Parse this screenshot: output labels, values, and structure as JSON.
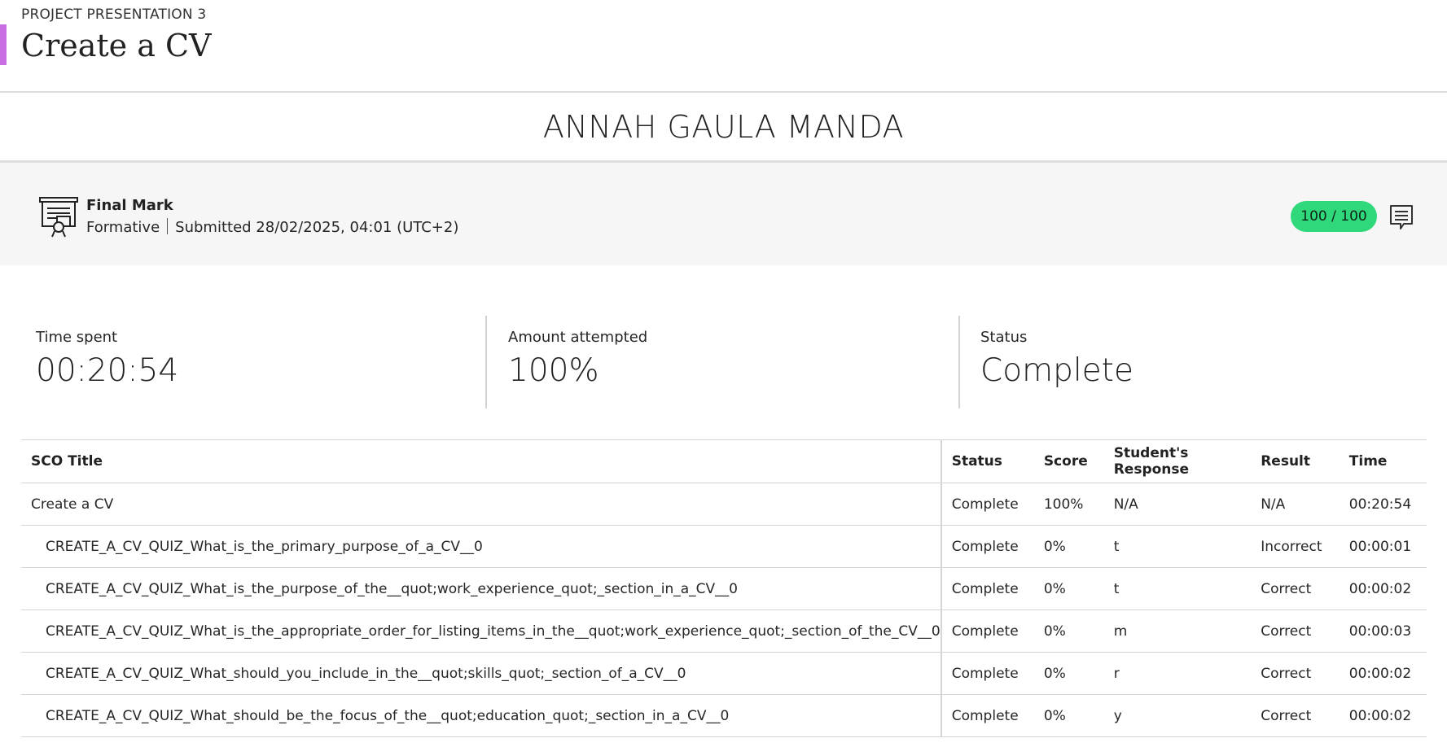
{
  "header": {
    "breadcrumb": "PROJECT PRESENTATION 3",
    "title": "Create a CV",
    "accent_color": "#c86ee0"
  },
  "student": {
    "name": "ANNAH GAULA MANDA"
  },
  "grade": {
    "icon": "certificate-icon",
    "label": "Final Mark",
    "type": "Formative",
    "submitted": "Submitted 28/02/2025, 04:01 (UTC+2)",
    "score": "100 / 100",
    "score_color": "#2fd87a",
    "comment_icon": "comment-icon"
  },
  "stats": {
    "time_spent": {
      "label": "Time spent",
      "value": "00:20:54"
    },
    "amount_attempted": {
      "label": "Amount attempted",
      "value": "100%"
    },
    "status": {
      "label": "Status",
      "value": "Complete"
    }
  },
  "table": {
    "headers": {
      "title": "SCO Title",
      "status": "Status",
      "score": "Score",
      "response": "Student's Response",
      "result": "Result",
      "time": "Time"
    },
    "rows": [
      {
        "title": "Create a CV",
        "status": "Complete",
        "score": "100%",
        "response": "N/A",
        "result": "N/A",
        "time": "00:20:54"
      },
      {
        "title": "CREATE_A_CV_QUIZ_What_is_the_primary_purpose_of_a_CV__0",
        "status": "Complete",
        "score": "0%",
        "response": "t",
        "result": "Incorrect",
        "time": "00:00:01"
      },
      {
        "title": "CREATE_A_CV_QUIZ_What_is_the_purpose_of_the__quot;work_experience_quot;_section_in_a_CV__0",
        "status": "Complete",
        "score": "0%",
        "response": "t",
        "result": "Correct",
        "time": "00:00:02"
      },
      {
        "title": "CREATE_A_CV_QUIZ_What_is_the_appropriate_order_for_listing_items_in_the__quot;work_experience_quot;_section_of_the_CV__0",
        "status": "Complete",
        "score": "0%",
        "response": "m",
        "result": "Correct",
        "time": "00:00:03"
      },
      {
        "title": "CREATE_A_CV_QUIZ_What_should_you_include_in_the__quot;skills_quot;_section_of_a_CV__0",
        "status": "Complete",
        "score": "0%",
        "response": "r",
        "result": "Correct",
        "time": "00:00:02"
      },
      {
        "title": "CREATE_A_CV_QUIZ_What_should_be_the_focus_of_the__quot;education_quot;_section_in_a_CV__0",
        "status": "Complete",
        "score": "0%",
        "response": "y",
        "result": "Correct",
        "time": "00:00:02"
      }
    ]
  }
}
